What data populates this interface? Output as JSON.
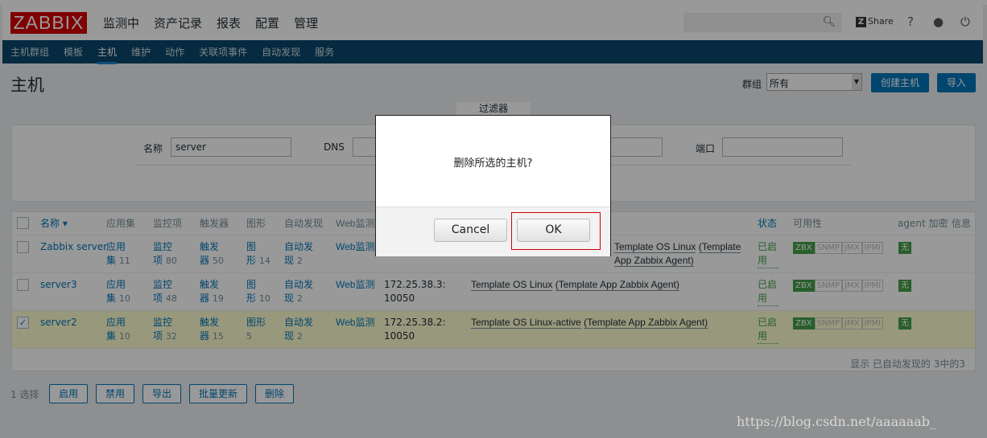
{
  "header": {
    "logo": "ZABBIX",
    "nav": [
      "监测中",
      "资产记录",
      "报表",
      "配置",
      "管理"
    ],
    "active_nav": "配置",
    "share": "Share",
    "icons": [
      "search-icon",
      "help-icon",
      "user-icon",
      "power-icon"
    ]
  },
  "subnav": {
    "items": [
      "主机群组",
      "模板",
      "主机",
      "维护",
      "动作",
      "关联项事件",
      "自动发现",
      "服务"
    ],
    "active": "主机"
  },
  "page": {
    "title": "主机",
    "group_label": "群组",
    "group_value": "所有",
    "create_button": "创建主机",
    "import_button": "导入"
  },
  "filter": {
    "tab": "过滤器",
    "name_label": "名称",
    "name_value": "server",
    "dns_label": "DNS",
    "dns_value": "",
    "port_label": "端口",
    "port_value": ""
  },
  "table": {
    "headers": {
      "name": "名称 ▾",
      "apps": "应用集",
      "items": "监控项",
      "triggers": "触发器",
      "graphs": "图形",
      "discovery": "自动发现",
      "web": "Web监测",
      "status": "状态",
      "availability": "可用性",
      "encryption": "agent 加密",
      "info": "信息"
    },
    "rows": [
      {
        "checked": false,
        "name": "Zabbix server",
        "apps": [
          "应用",
          "集",
          "11"
        ],
        "items": [
          "监控",
          "项",
          "80"
        ],
        "triggers": [
          "触发",
          "器",
          "50"
        ],
        "graphs": [
          "图",
          "形",
          "14"
        ],
        "discovery": [
          "自动发",
          "现",
          "2"
        ],
        "web": "Web监测",
        "interface": "",
        "templates_main": "Template OS Linux",
        "templates_sub": "(Template App Zabbix Agent)",
        "status": "已启用",
        "avail": [
          "ZBX",
          "SNMP",
          "JMX",
          "IPMI"
        ],
        "enc": "无"
      },
      {
        "checked": false,
        "name": "server3",
        "apps": [
          "应用",
          "集",
          "10"
        ],
        "items": [
          "监控",
          "项",
          "48"
        ],
        "triggers": [
          "触发",
          "器",
          "19"
        ],
        "graphs": [
          "图",
          "形",
          "10"
        ],
        "discovery": [
          "自动发",
          "现",
          "2"
        ],
        "web": "Web监测",
        "interface": "172.25.38.3: 10050",
        "templates_main": "Template OS Linux",
        "templates_sub": "(Template App Zabbix Agent)",
        "status": "已启用",
        "avail": [
          "ZBX",
          "SNMP",
          "JMX",
          "IPMI"
        ],
        "enc": "无"
      },
      {
        "checked": true,
        "name": "server2",
        "apps": [
          "应用",
          "集",
          "10"
        ],
        "items": [
          "监控",
          "项",
          "32"
        ],
        "triggers": [
          "触发",
          "器",
          "15"
        ],
        "graphs": [
          "图形",
          "",
          "5"
        ],
        "discovery": [
          "自动发",
          "现",
          "2"
        ],
        "web": "Web监测",
        "interface": "172.25.38.2: 10050",
        "templates_main": "Template OS Linux-active",
        "templates_sub": "(Template App Zabbix Agent)",
        "status": "已启用",
        "avail": [
          "ZBX",
          "SNMP",
          "JMX",
          "IPMI"
        ],
        "enc": "无"
      }
    ],
    "footer": "显示 已自动发现的 3中的3"
  },
  "actions": {
    "selected": "1 选择",
    "buttons": [
      "启用",
      "禁用",
      "导出",
      "批量更新",
      "删除"
    ]
  },
  "dialog": {
    "message": "删除所选的主机?",
    "cancel": "Cancel",
    "ok": "OK"
  },
  "watermark": "https://blog.csdn.net/aaaaaab_",
  "colors": {
    "brand": "#d40000",
    "nav": "#0a466a",
    "link": "#0275b8",
    "enabled": "#429e47",
    "highlight": "#d00000"
  }
}
